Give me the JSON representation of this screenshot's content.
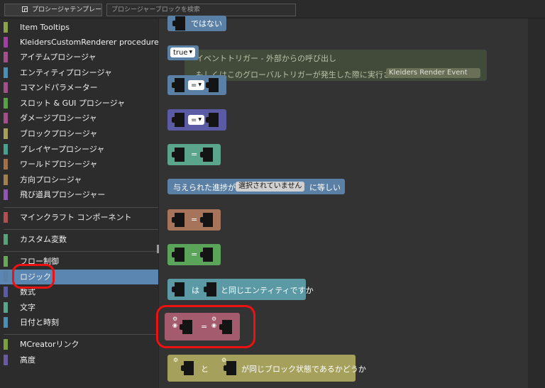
{
  "tabs": {
    "templates": "プロシージャテンプレート",
    "search_placeholder": "プロシージャーブロックを検索"
  },
  "categories": [
    {
      "label": "Item Tooltips",
      "color": "#8aa24a"
    },
    {
      "label": "KleidersCustomRenderer procedures",
      "color": "#a040a0"
    },
    {
      "label": "アイテムプロシージャ",
      "color": "#a24f8c"
    },
    {
      "label": "エンティティプロシージャ",
      "color": "#4d8fb0"
    },
    {
      "label": "コマンドパラメーター",
      "color": "#a24f8c"
    },
    {
      "label": "スロット & GUI プロシージャ",
      "color": "#5aa04a"
    },
    {
      "label": "ダメージプロシージャ",
      "color": "#a24f8c"
    },
    {
      "label": "ブロックプロシージャ",
      "color": "#a7a05a"
    },
    {
      "label": "プレイヤープロシージャ",
      "color": "#4aa08f"
    },
    {
      "label": "ワールドプロシージャ",
      "color": "#a0704a"
    },
    {
      "label": "方向プロシージャ",
      "color": "#a08050"
    },
    {
      "label": "飛び道具プロシージャー",
      "color": "#9055b0"
    },
    {
      "label": "マインクラフト コンポーネント",
      "color": "#b05050"
    },
    {
      "label": "カスタム変数",
      "color": "#5aa07a"
    },
    {
      "label": "フロー制御",
      "color": "#6aa65a"
    },
    {
      "label": "ロジック",
      "color": "#5b80a5"
    },
    {
      "label": "数式",
      "color": "#5b5ba5"
    },
    {
      "label": "文字",
      "color": "#5ba58c"
    },
    {
      "label": "日付と時刻",
      "color": "#4d8fb0"
    },
    {
      "label": "MCreatorリンク",
      "color": "#7aa040"
    },
    {
      "label": "高度",
      "color": "#6a5aa0"
    }
  ],
  "selected_category": "ロジック",
  "ghost": {
    "line1": "イベントトリガー - 外部からの呼び出し",
    "line2": "もしくはこのグローバルトリガーが発生した際に実行される",
    "event": "Kleiders Render Event"
  },
  "blocks": {
    "not_label": "ではない",
    "true_label": "true",
    "eq": "=",
    "advancement_prefix": "与えられた進捗が",
    "advancement_value": "選択されていません",
    "advancement_suffix": "に等しい",
    "entity_is": "は",
    "entity_same": "と同じエンティティですか",
    "blockstate_and": "と",
    "blockstate_same": "が同じブロック状態であるかどうか"
  },
  "colors": {
    "logic": "#5b80a5",
    "math": "#5b5ba5",
    "text": "#5ba58c",
    "advancement": "#5b80a5",
    "component": "#a5745b",
    "flow": "#5ba55b",
    "entity": "#5b9aa5",
    "item": "#a55b6e",
    "block": "#a5a05b",
    "highlight": "#ee1111"
  }
}
